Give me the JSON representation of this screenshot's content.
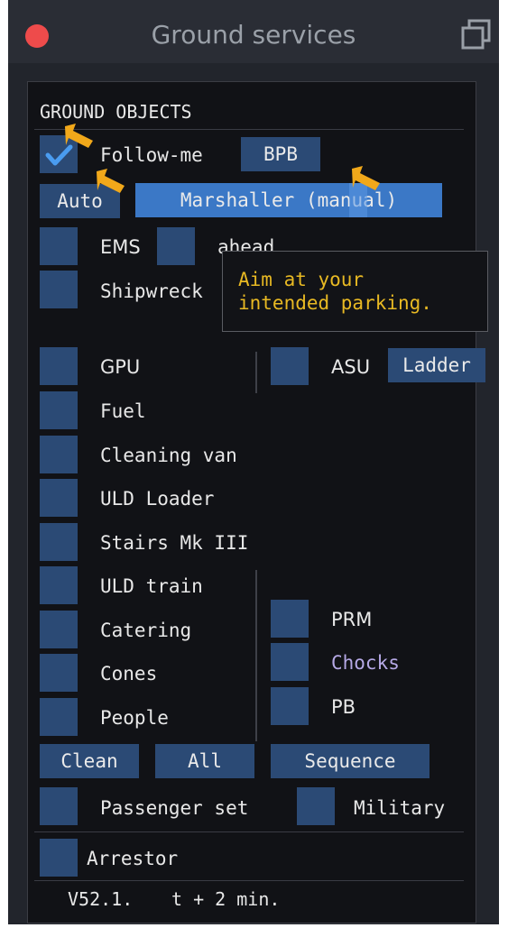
{
  "window": {
    "title": "Ground services"
  },
  "section": {
    "title": "GROUND OBJECTS"
  },
  "row1": {
    "follow_me": "Follow-me",
    "bpb": "BPB"
  },
  "row2": {
    "auto": "Auto",
    "marshaller": "Marshaller (manual)"
  },
  "row3": {
    "ems": "EMS",
    "ahead": "ahead"
  },
  "row4": {
    "shipwreck": "Shipwreck"
  },
  "tooltip": {
    "line1": "Aim at your",
    "line2": "intended parking."
  },
  "row5": {
    "gpu": "GPU",
    "asu": "ASU",
    "ladder": "Ladder"
  },
  "list": [
    "Fuel",
    "Cleaning van",
    "ULD Loader",
    "Stairs Mk III",
    "ULD train",
    "Catering",
    "Cones",
    "People"
  ],
  "right_list": [
    "PRM",
    "Chocks",
    "PB"
  ],
  "actions": {
    "clean": "Clean",
    "all": "All",
    "sequence": "Sequence"
  },
  "bottom": {
    "passenger_set": "Passenger set",
    "military": "Military",
    "arrestor": "Arrestor"
  },
  "footer": {
    "version": "V52.1.",
    "timer": "t + 2 min."
  },
  "colors": {
    "checkbox": "#2b4a75",
    "active_button": "#3b78c6",
    "tooltip_text": "#e8b923",
    "chocks_text": "#b6a9e6",
    "arrow": "#f1a81a",
    "close_dot": "#ee4b4b"
  }
}
